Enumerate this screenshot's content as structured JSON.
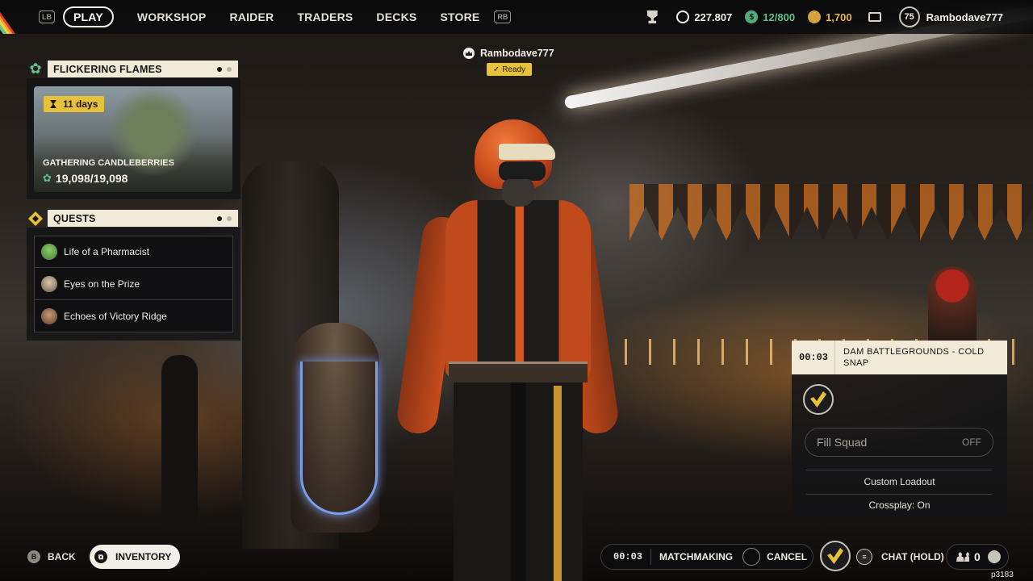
{
  "topbar": {
    "lb": "LB",
    "rb": "RB",
    "nav": [
      "PLAY",
      "WORKSHOP",
      "RAIDER",
      "TRADERS",
      "DECKS",
      "STORE"
    ],
    "active": "PLAY",
    "currency_main": "227.807",
    "tickets": "12/800",
    "coins": "1,700",
    "player_level": "75",
    "player_name": "Rambodave777",
    "colors": {
      "green": "#5ec08c",
      "gold": "#e8b444"
    }
  },
  "event": {
    "title": "FLICKERING FLAMES",
    "days": "11 days",
    "name": "GATHERING CANDLEBERRIES",
    "progress": "19,098/19,098"
  },
  "quests": {
    "title": "QUESTS",
    "items": [
      "Life of a Pharmacist",
      "Eyes on the Prize",
      "Echoes of Victory Ridge"
    ]
  },
  "party": {
    "leader": "Rambodave777",
    "status": "Ready"
  },
  "matchmaking": {
    "timer": "00:03",
    "map": "DAM BATTLEGROUNDS - COLD SNAP",
    "fill_squad_label": "Fill Squad",
    "fill_squad_value": "OFF",
    "custom_loadout": "Custom Loadout",
    "crossplay": "Crossplay: On"
  },
  "bottombar": {
    "back_key": "B",
    "back": "BACK",
    "inventory": "INVENTORY",
    "timer": "00:03",
    "matchmaking": "MATCHMAKING",
    "cancel": "CANCEL",
    "chat": "CHAT (HOLD)",
    "friends_count": "0",
    "build": "p3183"
  }
}
